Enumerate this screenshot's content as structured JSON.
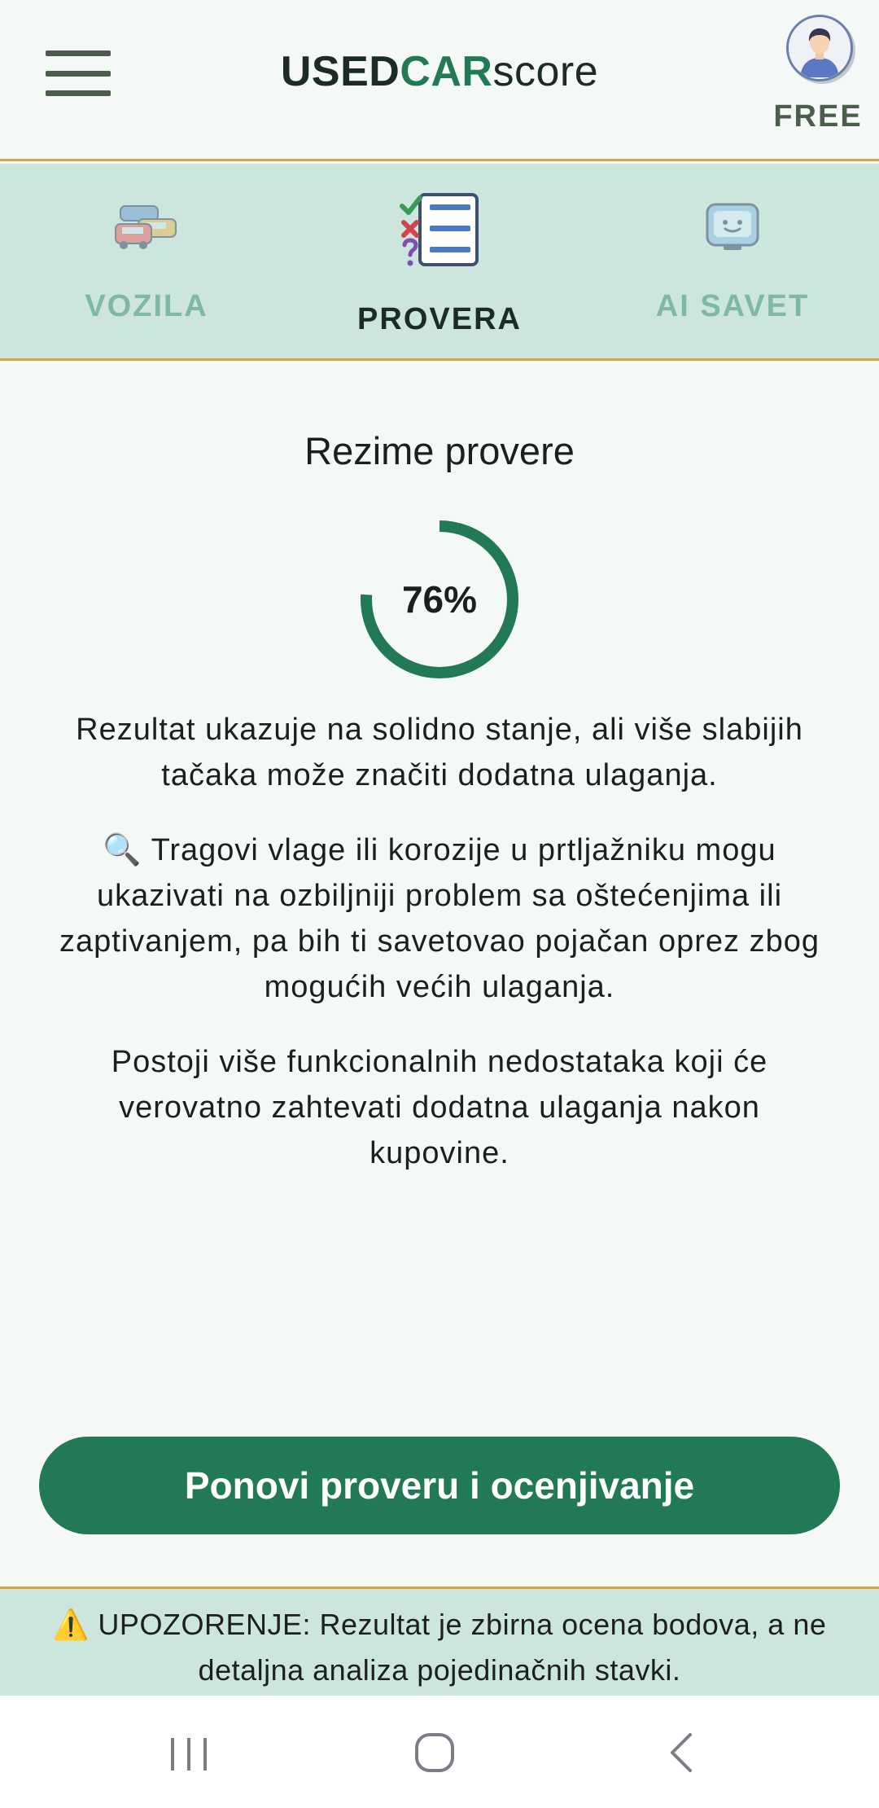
{
  "header": {
    "logo": {
      "part1": "USED",
      "part2": "CAR",
      "part3": "score"
    },
    "plan_badge": "FREE"
  },
  "tabs": [
    {
      "label": "VOZILA",
      "icon": "cars-icon",
      "active": false
    },
    {
      "label": "PROVERA",
      "icon": "checklist-icon",
      "active": true
    },
    {
      "label": "AI SAVET",
      "icon": "robot-icon",
      "active": false
    }
  ],
  "summary": {
    "title": "Rezime provere",
    "score_text": "76%",
    "score_value": 76,
    "paragraph1": "Rezultat ukazuje na solidno stanje, ali više slabijih tačaka može značiti dodatna ulaganja.",
    "paragraph2": "🔍 Tragovi vlage ili korozije u prtljažniku mogu ukazivati na ozbiljniji problem sa oštećenjima ili zaptivanjem, pa bih ti savetovao pojačan oprez zbog mogućih većih ulaganja.",
    "paragraph3": "Postoji više funkcionalnih nedostataka koji će verovatno zahtevati dodatna ulaganja nakon kupovine."
  },
  "actions": {
    "retry_label": "Ponovi proveru i ocenjivanje"
  },
  "warning": {
    "text": "⚠️ UPOZORENJE: Rezultat je zbirna ocena bodova, a ne detaljna analiza pojedinačnih stavki."
  },
  "colors": {
    "accent": "#227955",
    "tab_bg": "#cde6dd",
    "divider": "#d9a441"
  }
}
